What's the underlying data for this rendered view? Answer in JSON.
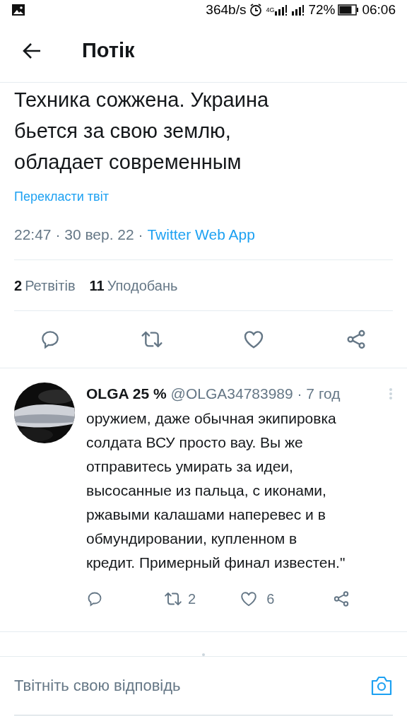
{
  "status_bar": {
    "speed": "364b/s",
    "network": "4G",
    "battery_percent": "72%",
    "time": "06:06"
  },
  "header": {
    "title": "Потік"
  },
  "tweet": {
    "text": "Техника сожжена. Украина\nбьется за свою землю,\nобладает современным",
    "translate_link": "Перекласти твіт",
    "time": "22:47 · 30 вер. 22 · ",
    "source": "Twitter Web App",
    "retweets_count": "2",
    "retweets_label": "Ретвітів",
    "likes_count": "11",
    "likes_label": "Уподобань"
  },
  "reply": {
    "name": "OLGA 25 %",
    "handle": "@OLGA34783989 · 7 год",
    "text": "оружием, даже обычная экипировка\nсолдата ВСУ просто вау. Вы же\nотправитесь умирать за идеи,\nвысосанные из пальца, с иконами,\nржавыми калашами наперевес и в\nобмундировании, купленном в\nкредит. Примерный финал известен.\"",
    "retweets": "2",
    "likes": "6"
  },
  "composer": {
    "placeholder": "Твітніть свою відповідь"
  }
}
